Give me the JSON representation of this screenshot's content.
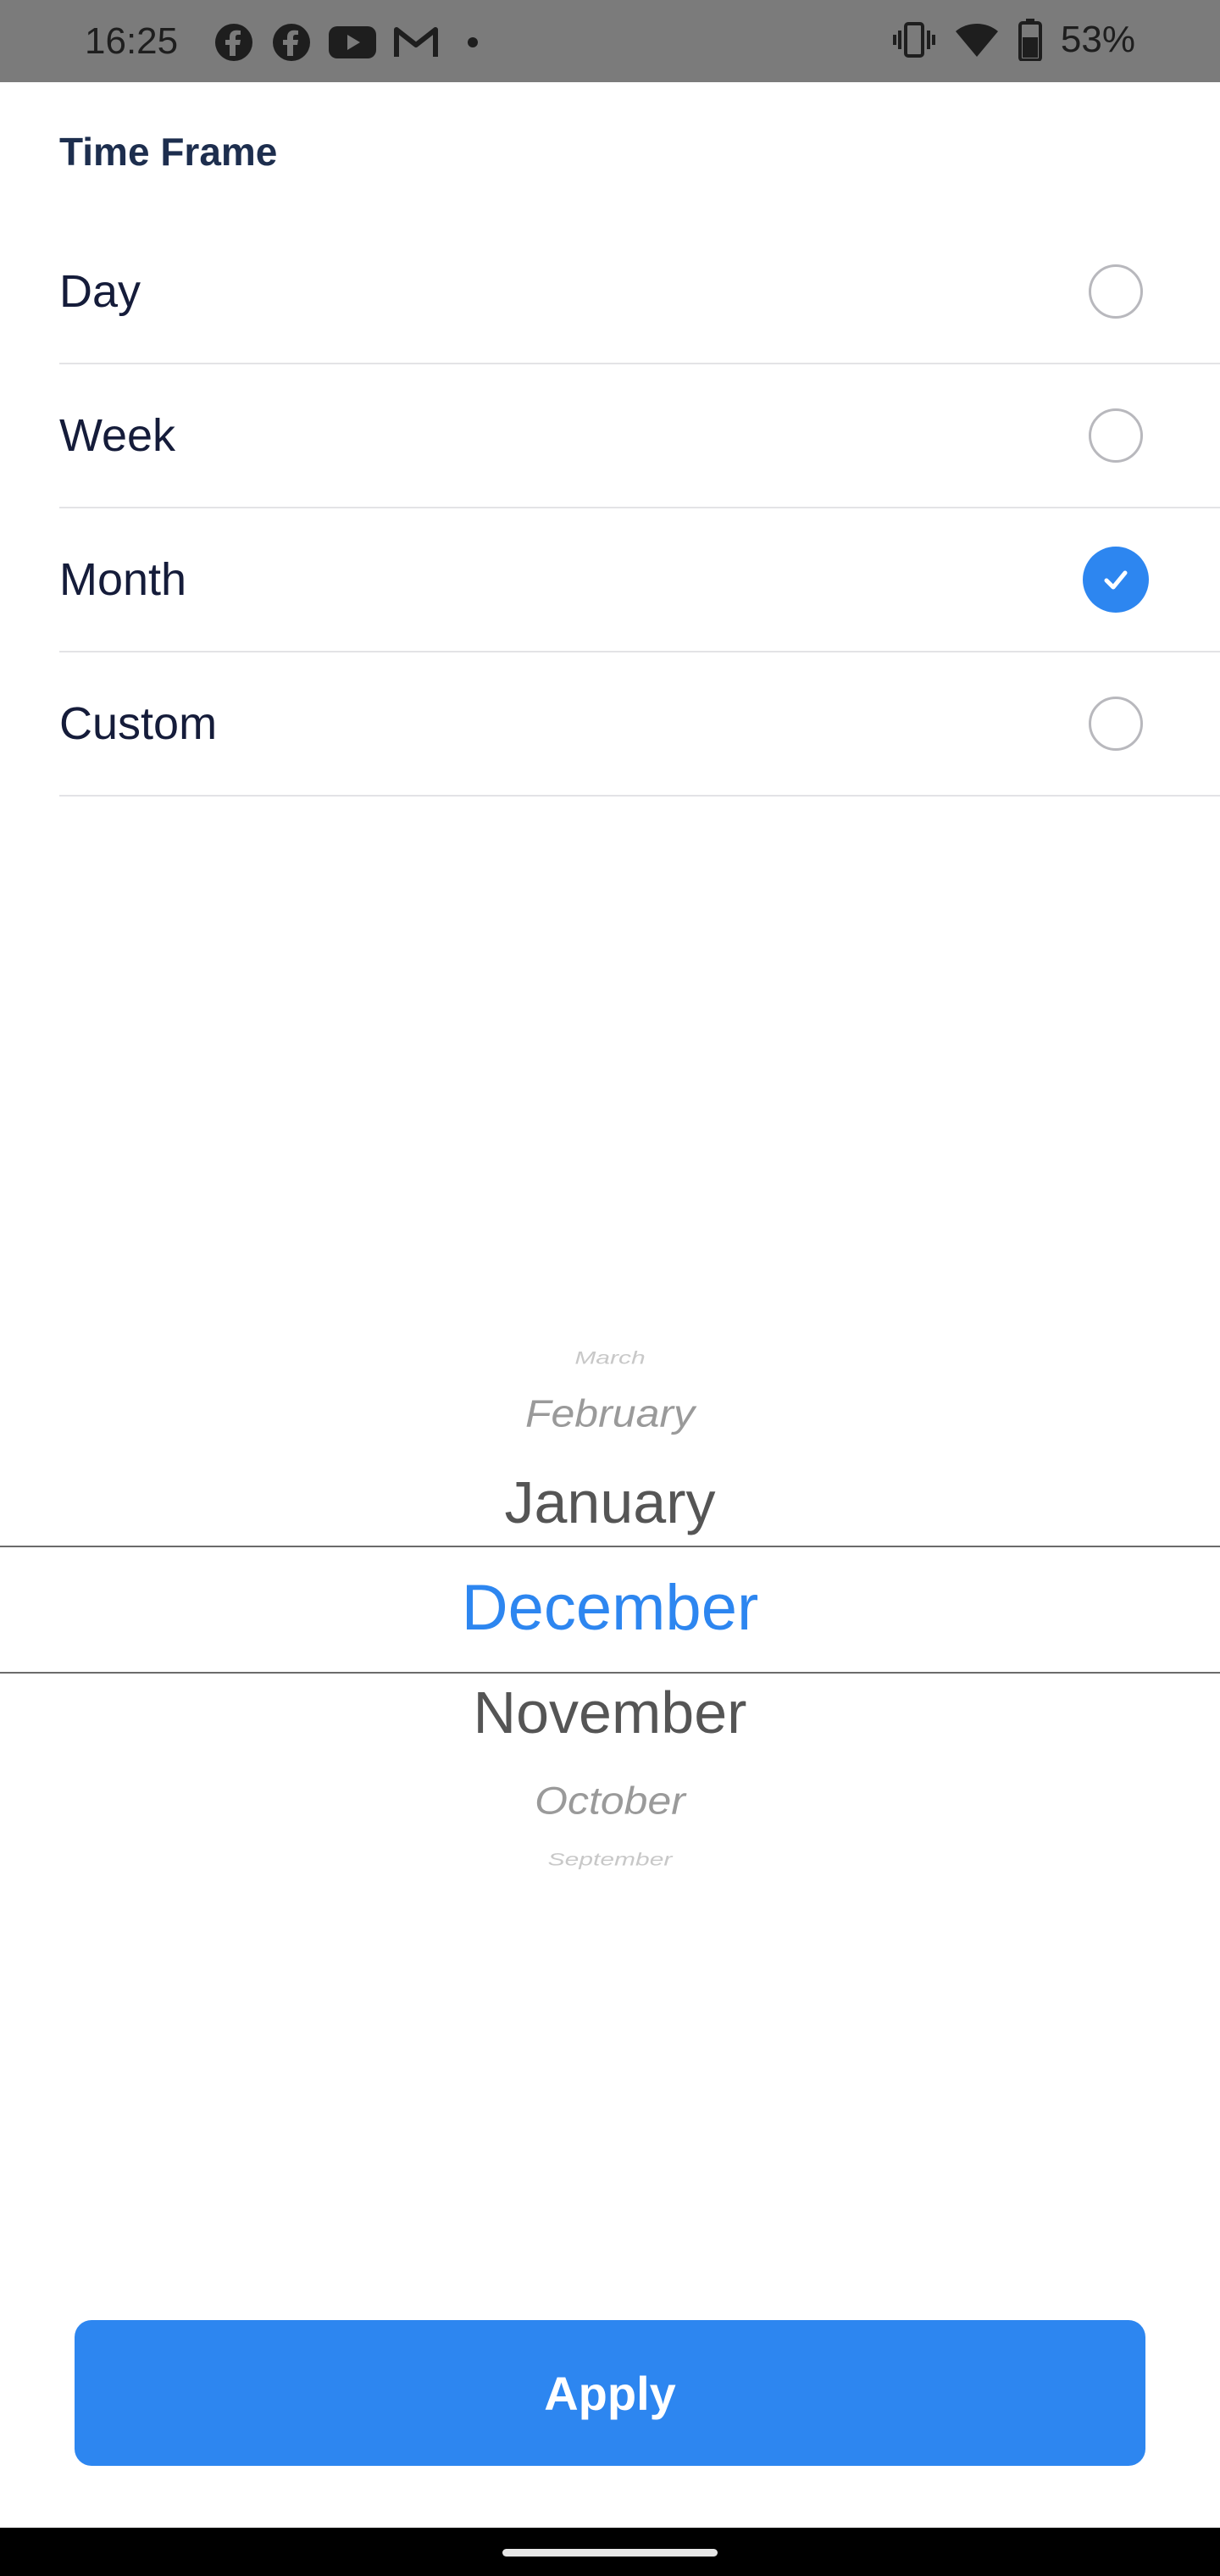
{
  "status_bar": {
    "time": "16:25",
    "battery_percent": "53%",
    "notification_icons": [
      "facebook-icon",
      "facebook-icon",
      "youtube-icon",
      "gmail-icon",
      "dot-icon"
    ],
    "system_icons": [
      "vibrate-icon",
      "wifi-icon",
      "battery-icon"
    ]
  },
  "section": {
    "title": "Time Frame"
  },
  "options": [
    {
      "label": "Day",
      "selected": false
    },
    {
      "label": "Week",
      "selected": false
    },
    {
      "label": "Month",
      "selected": true
    },
    {
      "label": "Custom",
      "selected": false
    }
  ],
  "picker": {
    "items": [
      "March",
      "February",
      "January",
      "December",
      "November",
      "October",
      "September"
    ],
    "selected": "December"
  },
  "apply": {
    "label": "Apply"
  },
  "colors": {
    "accent": "#2d86f0",
    "status_bar": "#7b7b7b",
    "text_primary": "#151c3a",
    "section_title": "#1d2e4e",
    "divider": "#e3e3e6"
  }
}
